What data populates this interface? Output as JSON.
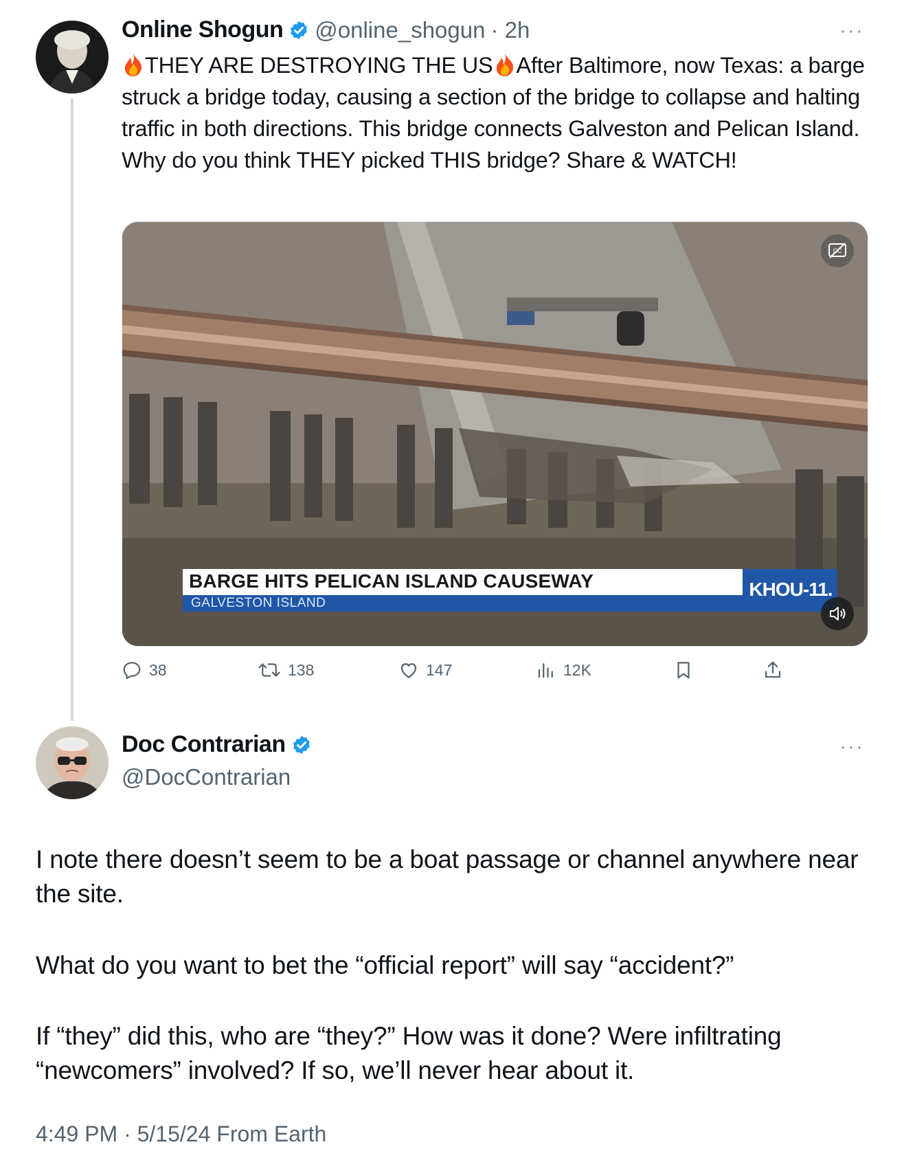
{
  "post": {
    "author_name": "Online Shogun",
    "handle": "@online_shogun",
    "time": "· 2h",
    "more": "···",
    "text_line1_part1": "THEY ARE DESTROYING THE US",
    "text_line1_part2": "After Baltimore, now Texas: a",
    "text_rest": "barge struck a bridge today, causing a section of the bridge to collapse and halting traffic in both directions. This bridge connects Galveston and Pelican Island. Why do you think THEY picked THIS bridge? Share & WATCH!",
    "emoji_icon": "fire-emoji",
    "media": {
      "headline": "BARGE HITS PELICAN ISLAND CAUSEWAY",
      "subheadline": "GALVESTON ISLAND",
      "station": "KHOU-11."
    },
    "stats": {
      "replies": "38",
      "reposts": "138",
      "likes": "147",
      "views": "12K"
    }
  },
  "reply": {
    "author_name": "Doc Contrarian",
    "handle": "@DocContrarian",
    "more": "···",
    "paragraph1": "I note there doesn’t seem to be a boat passage or channel anywhere near the site.",
    "paragraph2": "What do you want to bet the “official report” will say “accident?”",
    "paragraph3": "If “they” did this, who are “they?” How was it done? Were infiltrating “newcomers” involved? If so, we’ll never hear about it.",
    "timestamp": "4:49 PM · 5/15/24 From Earth"
  },
  "colors": {
    "verified": "#1d9bf0",
    "muted_text": "#536471",
    "thread_line": "#cfd9de",
    "chyron_blue": "#1f56a6"
  }
}
